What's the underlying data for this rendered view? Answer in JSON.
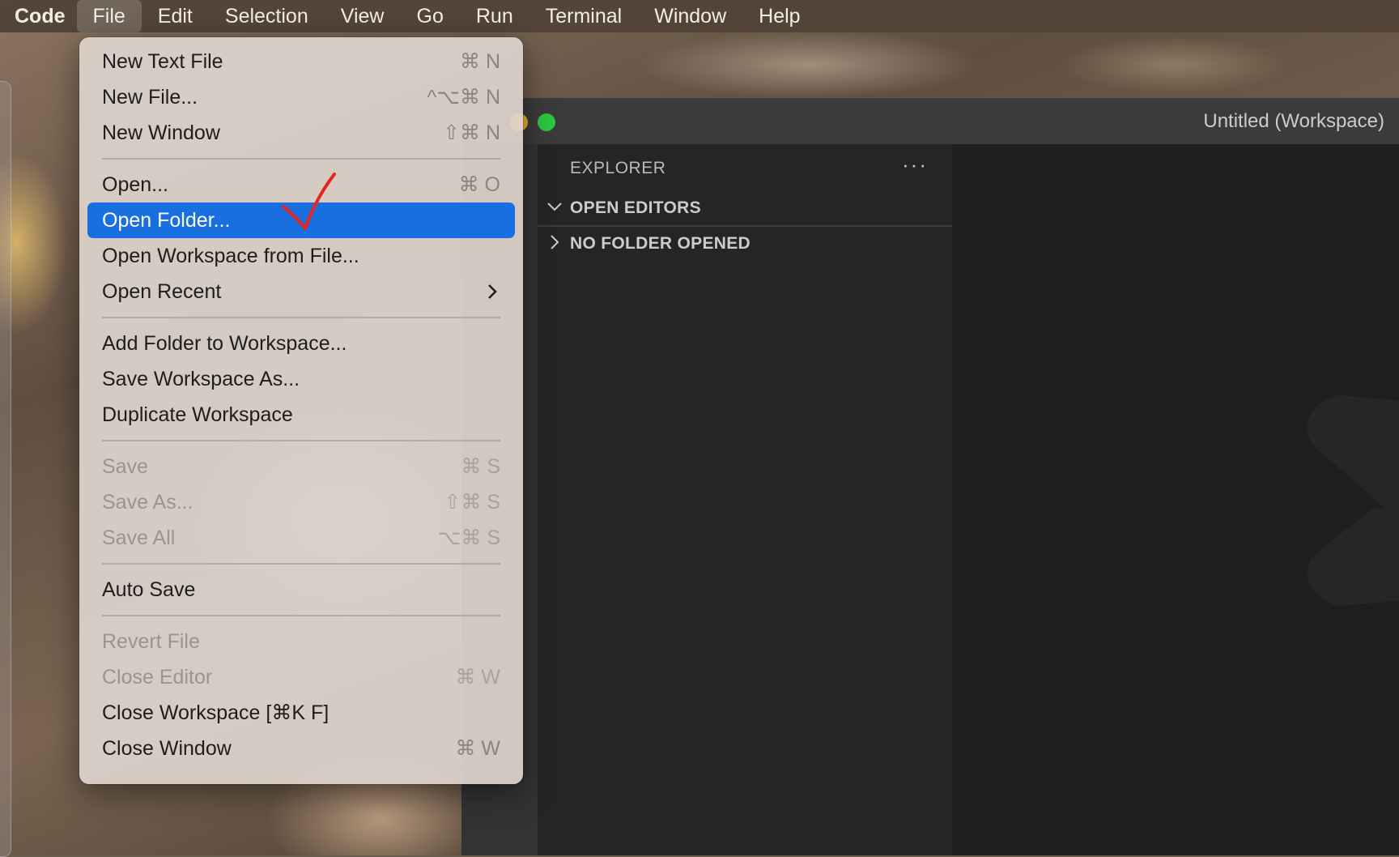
{
  "menubar": {
    "app_name": "Code",
    "items": [
      "File",
      "Edit",
      "Selection",
      "View",
      "Go",
      "Run",
      "Terminal",
      "Window",
      "Help"
    ]
  },
  "file_menu": {
    "groups": [
      [
        {
          "label": "New Text File",
          "shortcut": "⌘ N",
          "enabled": true
        },
        {
          "label": "New File...",
          "shortcut": "^⌥⌘ N",
          "enabled": true
        },
        {
          "label": "New Window",
          "shortcut": "⇧⌘ N",
          "enabled": true
        }
      ],
      [
        {
          "label": "Open...",
          "shortcut": "⌘ O",
          "enabled": true
        },
        {
          "label": "Open Folder...",
          "shortcut": "",
          "enabled": true,
          "highlighted": true
        },
        {
          "label": "Open Workspace from File...",
          "shortcut": "",
          "enabled": true
        },
        {
          "label": "Open Recent",
          "shortcut": "",
          "enabled": true,
          "submenu": true
        }
      ],
      [
        {
          "label": "Add Folder to Workspace...",
          "shortcut": "",
          "enabled": true
        },
        {
          "label": "Save Workspace As...",
          "shortcut": "",
          "enabled": true
        },
        {
          "label": "Duplicate Workspace",
          "shortcut": "",
          "enabled": true
        }
      ],
      [
        {
          "label": "Save",
          "shortcut": "⌘ S",
          "enabled": false
        },
        {
          "label": "Save As...",
          "shortcut": "⇧⌘ S",
          "enabled": false
        },
        {
          "label": "Save All",
          "shortcut": "⌥⌘ S",
          "enabled": false
        }
      ],
      [
        {
          "label": "Auto Save",
          "shortcut": "",
          "enabled": true
        }
      ],
      [
        {
          "label": "Revert File",
          "shortcut": "",
          "enabled": false
        },
        {
          "label": "Close Editor",
          "shortcut": "⌘ W",
          "enabled": false
        },
        {
          "label": "Close Workspace [⌘K F]",
          "shortcut": "",
          "enabled": true
        },
        {
          "label": "Close Window",
          "shortcut": "⌘ W",
          "enabled": true
        }
      ]
    ]
  },
  "window": {
    "title": "Untitled (Workspace)"
  },
  "explorer": {
    "header": "EXPLORER",
    "more_actions": "···",
    "sections": [
      {
        "label": "OPEN EDITORS",
        "expanded": true
      },
      {
        "label": "NO FOLDER OPENED",
        "expanded": false
      }
    ]
  },
  "colors": {
    "highlight": "#1a6fe0",
    "annotation_check": "#e5261f",
    "traffic_green": "#2ac840"
  }
}
